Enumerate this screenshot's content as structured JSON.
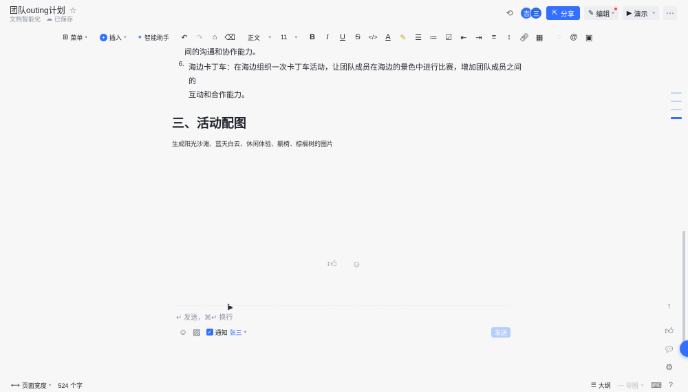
{
  "header": {
    "title": "团队outing计划",
    "star_icon": "star-icon",
    "tag": "文档智能化",
    "saved": "已保存",
    "avatars": [
      "吉",
      "三"
    ],
    "share_label": "分享",
    "edit_label": "编辑",
    "present_label": "演示"
  },
  "toolbar": {
    "menu_label": "菜单",
    "insert_label": "插入",
    "ai_label": "智能助手",
    "style_label": "正文",
    "font_size": "11"
  },
  "doc": {
    "prev_line": "间的沟通和协作能力。",
    "item_num": "6.",
    "item_text_1": "海边卡丁车：在海边组织一次卡丁车活动，让团队成员在海边的景色中进行比赛，增加团队成员之间的",
    "item_text_2": "互动和合作能力。",
    "heading": "三、活动配图",
    "caption": "生成阳光沙滩、蓝天白云、休闲体验、躺椅、棕榈树的图片"
  },
  "comment": {
    "hint": "↵ 发送，⌘↵ 换行",
    "notify_label": "通知",
    "mention": "张三",
    "send_label": "发送"
  },
  "status": {
    "page_width_label": "页面宽度",
    "word_count": "524 个字",
    "outline_label": "大纲",
    "limit_label": "导图"
  },
  "colors": {
    "accent": "#3370ff",
    "background": "#f7f7f8"
  }
}
